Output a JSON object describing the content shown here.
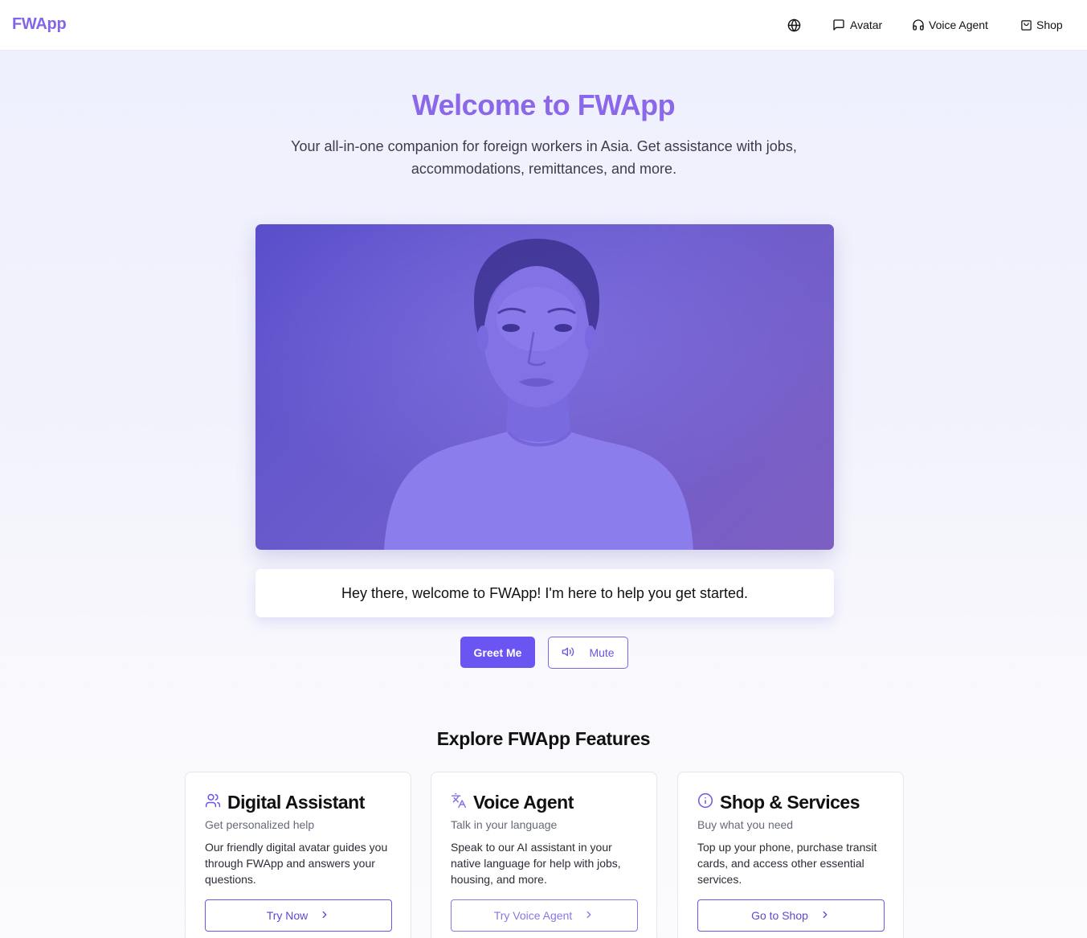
{
  "header": {
    "logo": "FWApp",
    "nav": [
      {
        "label": "",
        "icon": "globe-icon"
      },
      {
        "label": "Avatar",
        "icon": "message-square-icon"
      },
      {
        "label": "Voice Agent",
        "icon": "headphones-icon"
      },
      {
        "label": "Shop",
        "icon": "shopping-bag-icon"
      }
    ]
  },
  "hero": {
    "title": "Welcome to FWApp",
    "subtitle": "Your all-in-one companion for foreign workers in Asia. Get assistance with jobs, accommodations, remittances, and more."
  },
  "avatar": {
    "speech": "Hey there, welcome to FWApp! I'm here to help you get started.",
    "greet_label": "Greet Me",
    "mute_label": "Mute",
    "mute_icon": "volume-icon"
  },
  "features": {
    "title": "Explore FWApp Features",
    "cards": [
      {
        "title": "Digital Assistant",
        "subtitle": "Get personalized help",
        "description": "Our friendly digital avatar guides you through FWApp and answers your questions.",
        "button": "Try Now",
        "icon": "users-icon"
      },
      {
        "title": "Voice Agent",
        "subtitle": "Talk in your language",
        "description": "Speak to our AI assistant in your native language for help with jobs, housing, and more.",
        "button": "Try Voice Agent",
        "icon": "languages-icon"
      },
      {
        "title": "Shop & Services",
        "subtitle": "Buy what you need",
        "description": "Top up your phone, purchase transit cards, and access other essential services.",
        "button": "Go to Shop",
        "icon": "info-icon"
      }
    ]
  },
  "colors": {
    "brand": "#8b67e9",
    "primary_button": "#6b55f2",
    "avatar_tint": "#6b5ccd"
  }
}
